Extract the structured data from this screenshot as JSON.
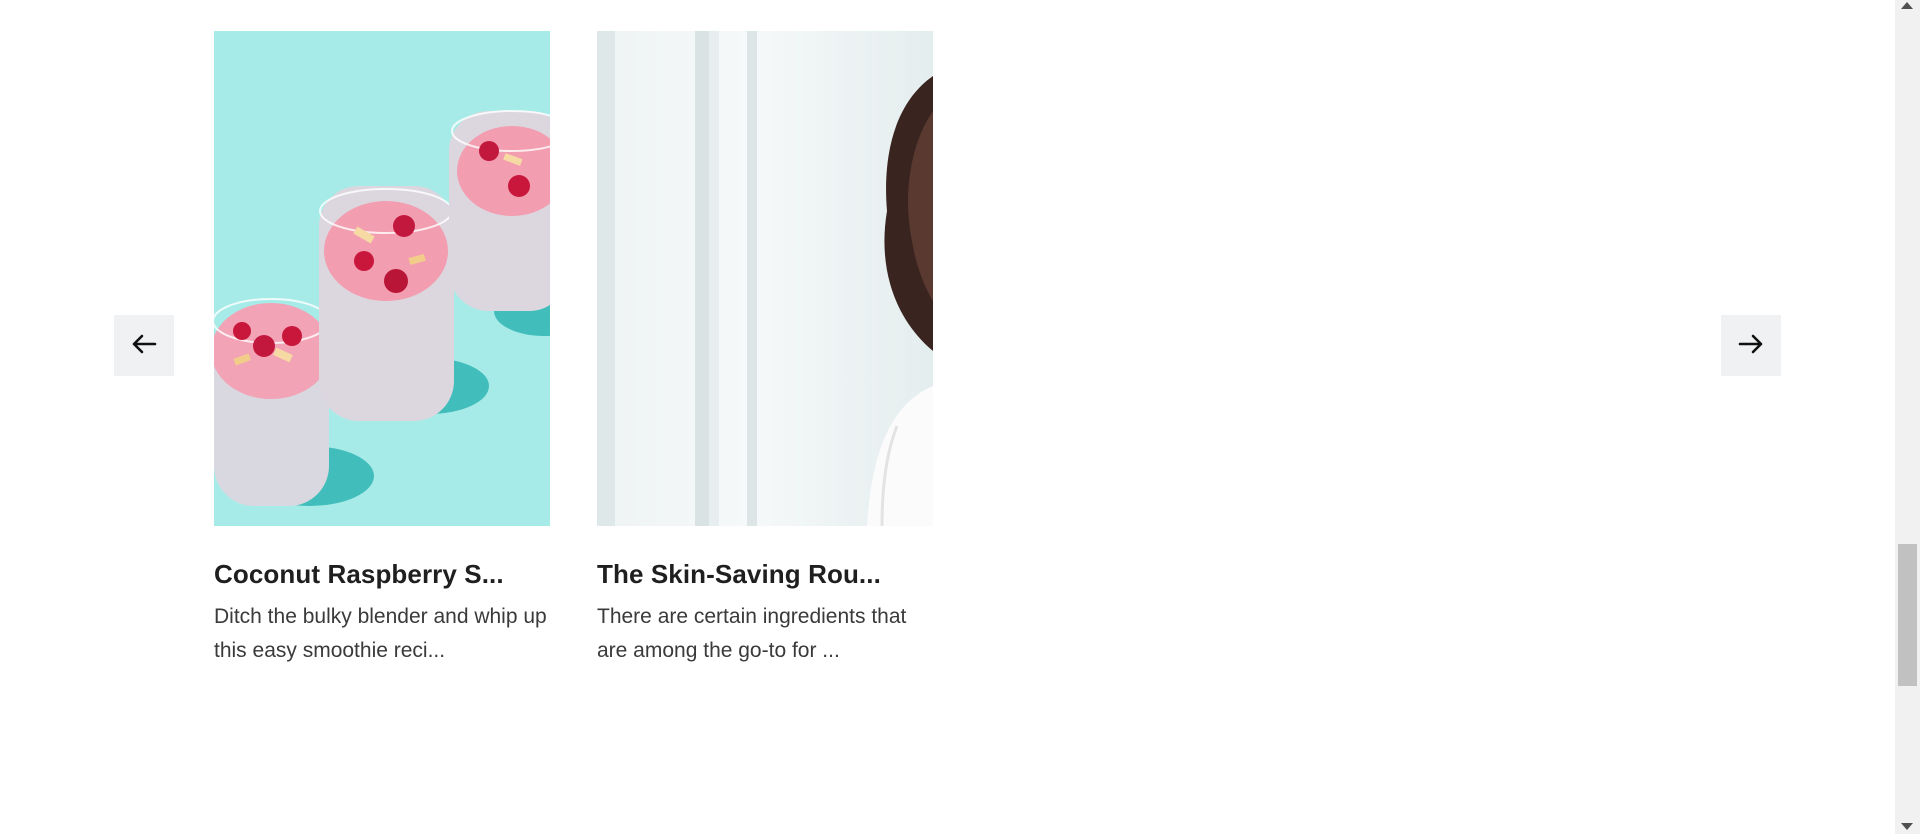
{
  "carousel": {
    "prev_icon": "arrow-left-icon",
    "next_icon": "arrow-right-icon",
    "cards": [
      {
        "title": "Coconut Raspberry S...",
        "excerpt": "Ditch the bulky blender and whip up this easy smoothie reci...",
        "image": "raspberry-smoothie-glasses-image",
        "image_bg": "#a7ebe8"
      },
      {
        "title": "The Skin-Saving Rou...",
        "excerpt": "There are certain ingredients that are among the go-to for ...",
        "image": "woman-mirror-image",
        "image_bg": "#e8eff0"
      }
    ]
  },
  "colors": {
    "nav_button_bg": "#f0f1f2",
    "title_text": "#1f1f1f",
    "body_text": "#3a3a3a"
  }
}
